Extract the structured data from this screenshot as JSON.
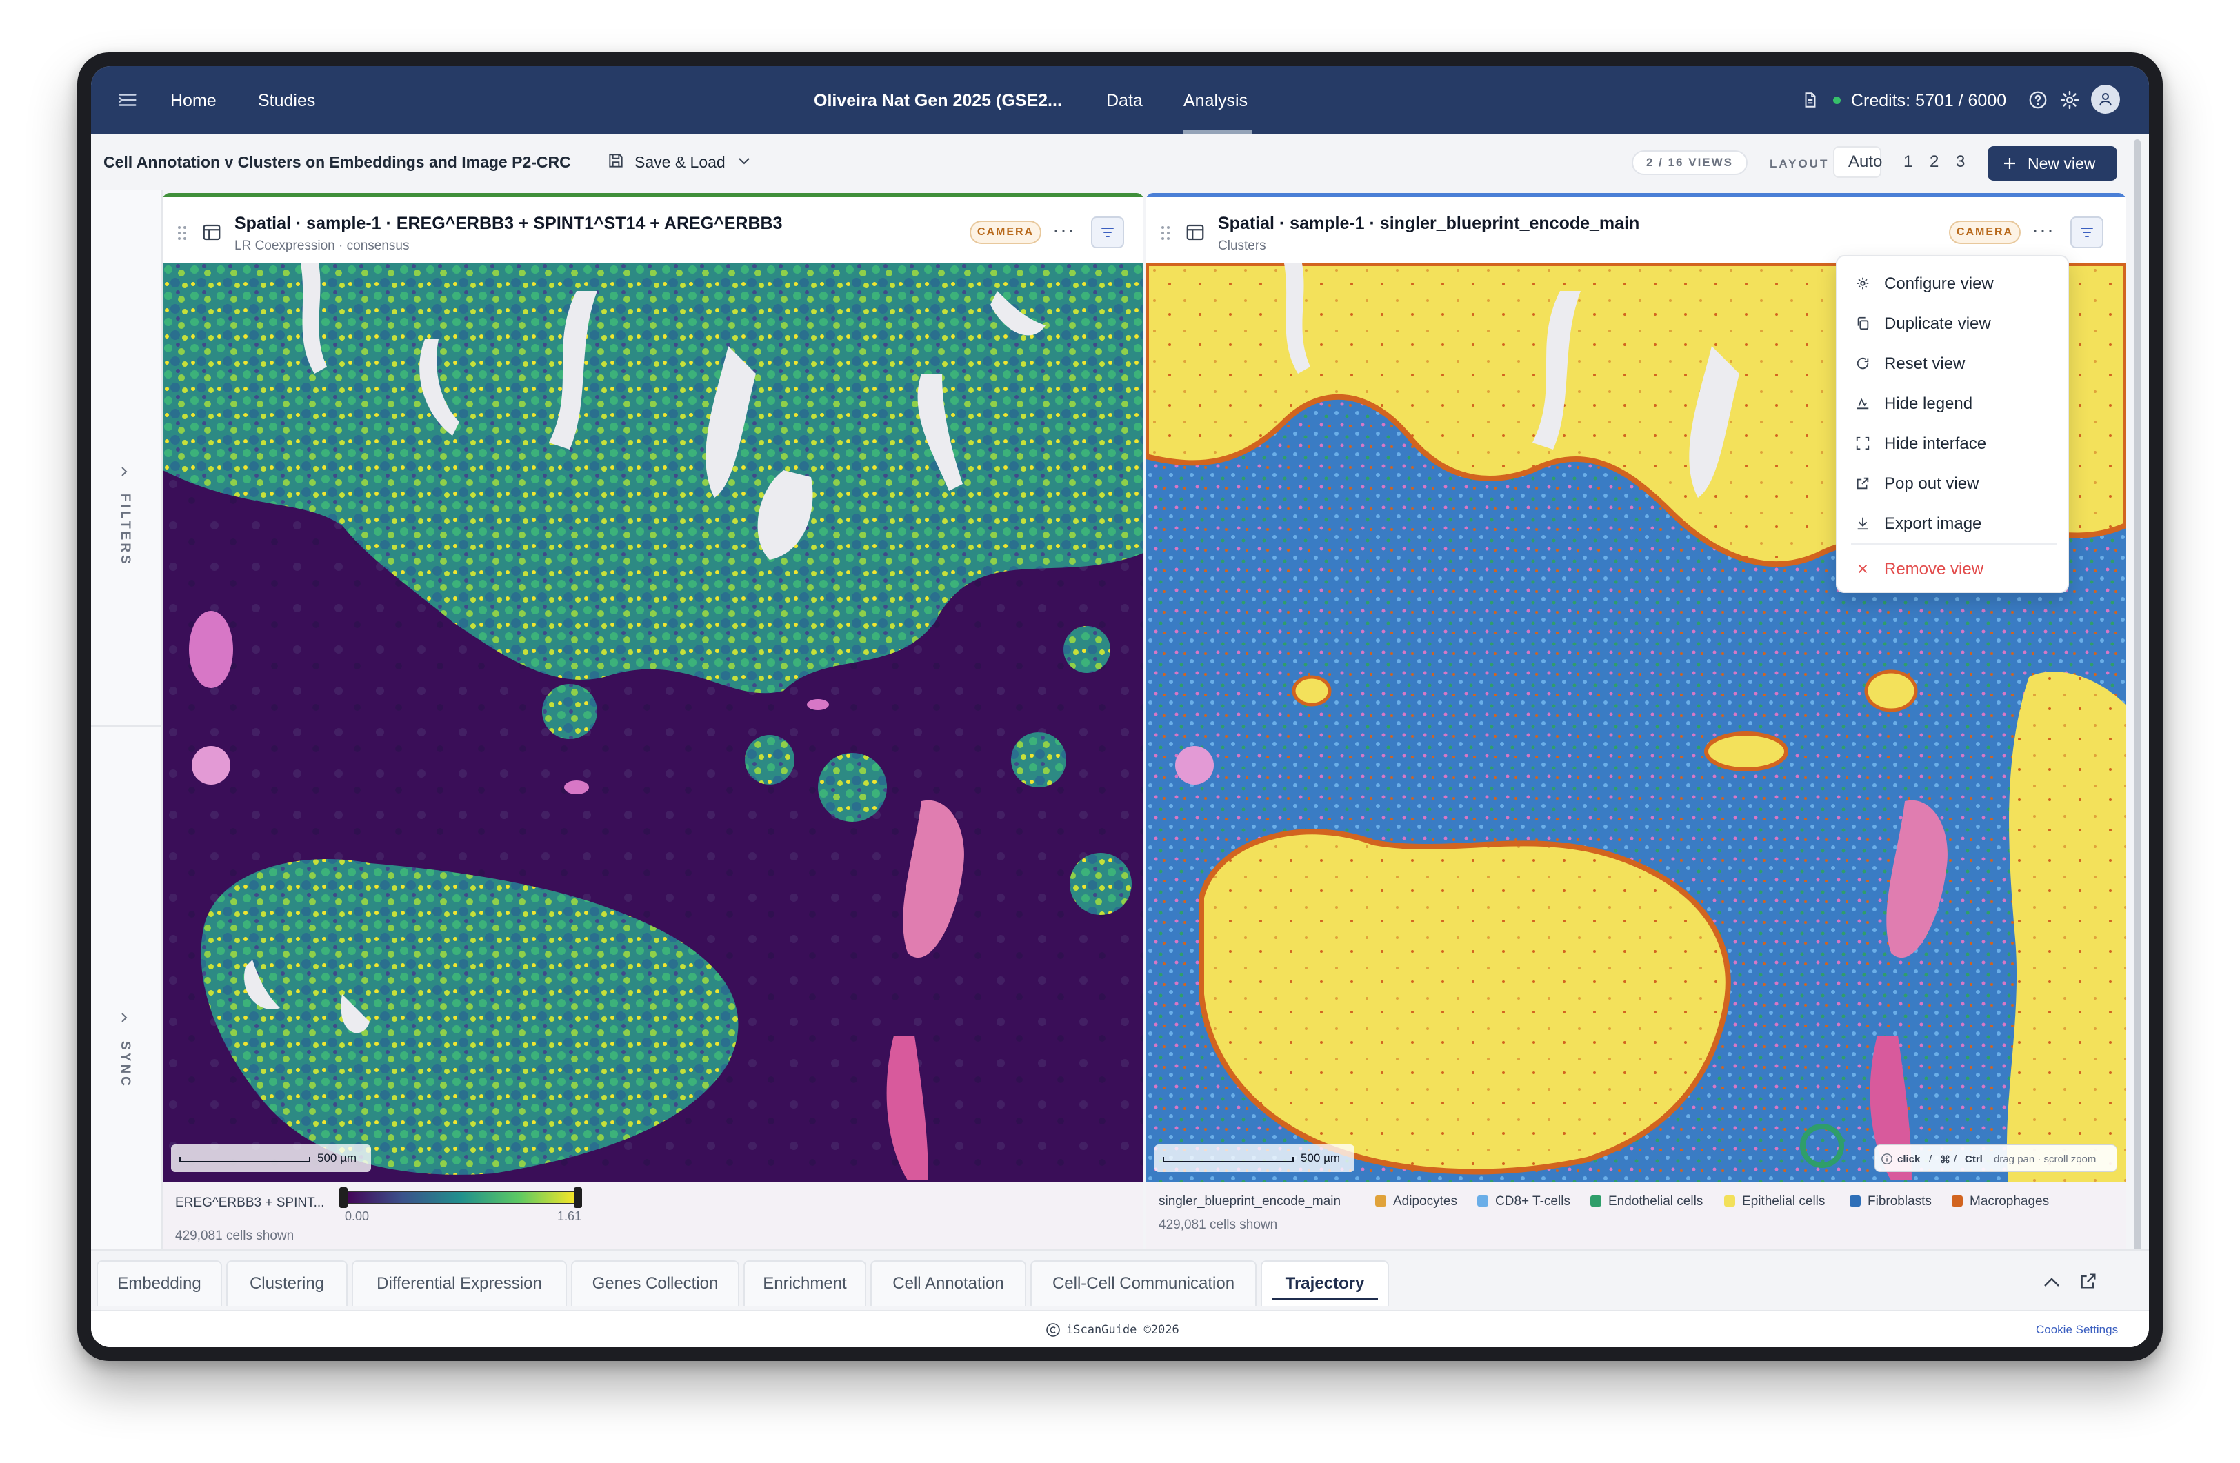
{
  "nav": {
    "home": "Home",
    "studies": "Studies",
    "study_title": "Oliveira Nat Gen 2025 (GSE2...",
    "data": "Data",
    "analysis": "Analysis",
    "credits": "Credits: 5701 / 6000"
  },
  "toolbar": {
    "title": "Cell Annotation v Clusters on Embeddings and Image P2-CRC",
    "save_load": "Save & Load",
    "views_badge": "2 / 16 VIEWS",
    "layout_label": "LAYOUT",
    "layout_options": [
      "Auto",
      "1",
      "2",
      "3"
    ],
    "new_view": "New view"
  },
  "rail": {
    "filters": "FILTERS",
    "sync": "SYNC"
  },
  "panels": [
    {
      "title": "Spatial · sample-1 · EREG^ERBB3 + SPINT1^ST14 + AREG^ERBB3",
      "subtitle": "LR Coexpression · consensus",
      "camera": "CAMERA",
      "scale": "500 µm",
      "legend_label": "EREG^ERBB3 + SPINT...",
      "range_min": "0.00",
      "range_max": "1.61",
      "cells_shown": "429,081 cells shown",
      "accent": "#3f8f3a"
    },
    {
      "title": "Spatial · sample-1 · singler_blueprint_encode_main",
      "subtitle": "Clusters",
      "camera": "CAMERA",
      "scale": "500 µm",
      "legend_label": "singler_blueprint_encode_main",
      "legend": [
        {
          "label": "Adipocytes",
          "color": "#e0a23a"
        },
        {
          "label": "CD8+ T-cells",
          "color": "#6aaee8"
        },
        {
          "label": "Endothelial cells",
          "color": "#2f9e6a"
        },
        {
          "label": "Epithelial cells",
          "color": "#f2e05a"
        },
        {
          "label": "Fibroblasts",
          "color": "#2e6fb8"
        },
        {
          "label": "Macrophages",
          "color": "#d2641f"
        }
      ],
      "cells_shown": "429,081 cells shown",
      "hint_click": "click",
      "hint_sep1": "/",
      "hint_cmd": "⌘",
      "hint_sep2": "/",
      "hint_ctrl": "Ctrl",
      "hint_rest": "drag pan · scroll zoom",
      "accent": "#4a7fd6"
    }
  ],
  "context_menu": {
    "items": [
      "Configure view",
      "Duplicate view",
      "Reset view",
      "Hide legend",
      "Hide interface",
      "Pop out view",
      "Export image"
    ],
    "danger_item": "Remove view"
  },
  "tabs": {
    "items": [
      "Embedding",
      "Clustering",
      "Differential Expression",
      "Genes Collection",
      "Enrichment",
      "Cell Annotation",
      "Cell-Cell Communication",
      "Trajectory"
    ],
    "active": "Trajectory"
  },
  "footer": {
    "brand": "iScanGuide ©2026",
    "cookie": "Cookie Settings"
  }
}
